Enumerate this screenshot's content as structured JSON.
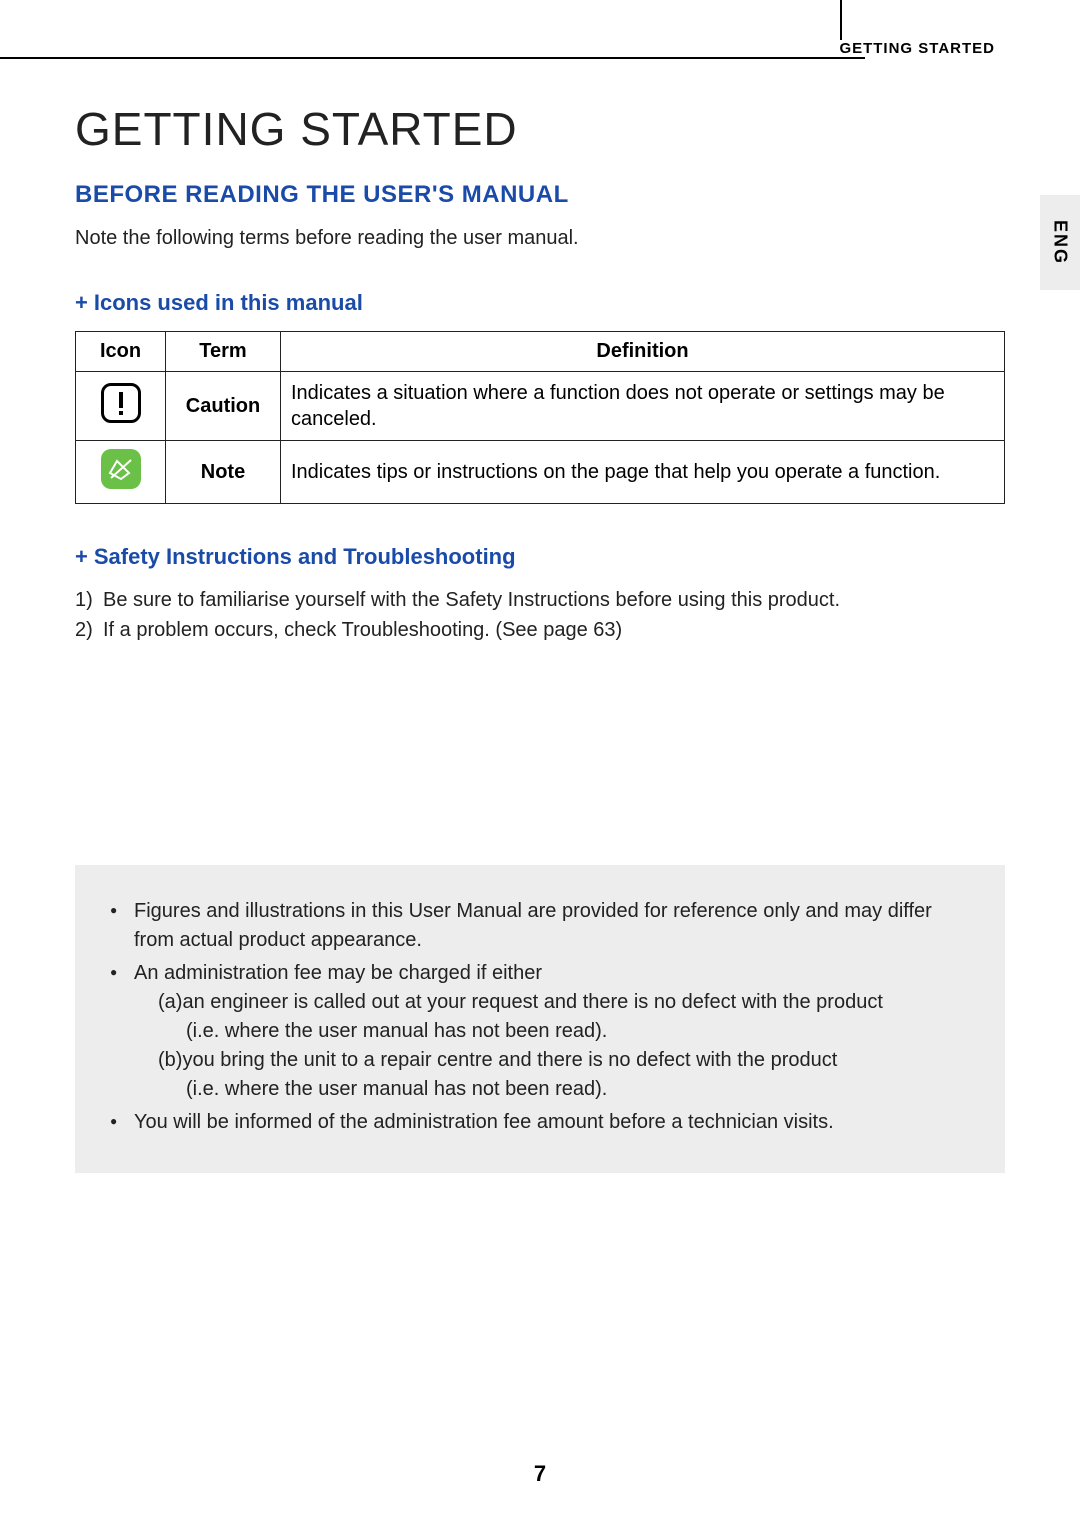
{
  "header": {
    "running_title": "GETTING STARTED"
  },
  "title": "GETTING STARTED",
  "section": {
    "heading": "BEFORE READING THE USER'S MANUAL",
    "intro": "Note the following terms before reading the user manual."
  },
  "icons_section": {
    "heading": "Icons used in this manual",
    "plus": "+",
    "headers": {
      "icon": "Icon",
      "term": "Term",
      "definition": "Definition"
    },
    "rows": [
      {
        "term": "Caution",
        "definition": "Indicates a situation where a function does not operate or settings may be canceled."
      },
      {
        "term": "Note",
        "definition": "Indicates tips or instructions on the page that help you operate a function."
      }
    ]
  },
  "safety_section": {
    "heading": "Safety Instructions and Troubleshooting",
    "plus": "+",
    "items": [
      {
        "num": "1)",
        "text": "Be sure to familiarise yourself with the Safety Instructions before using this product."
      },
      {
        "num": "2)",
        "text": "If a problem occurs, check Troubleshooting. (See page 63)"
      }
    ]
  },
  "notice": {
    "items": [
      "Figures and illustrations in this User Manual are provided for reference only and may differ from actual product appearance.",
      "An administration fee may be charged if either",
      "You will be informed of the administration fee amount before a technician visits."
    ],
    "sub_a_label": "(a)",
    "sub_a": "an engineer is called out at your request and there is no defect with the product",
    "sub_a2": "(i.e. where the user manual has not been read).",
    "sub_b_label": "(b)",
    "sub_b": "you bring the unit to a repair centre and there is no defect with the product",
    "sub_b2": "(i.e. where the user manual has not been read)."
  },
  "page_number": "7",
  "lang_tab": "ENG"
}
